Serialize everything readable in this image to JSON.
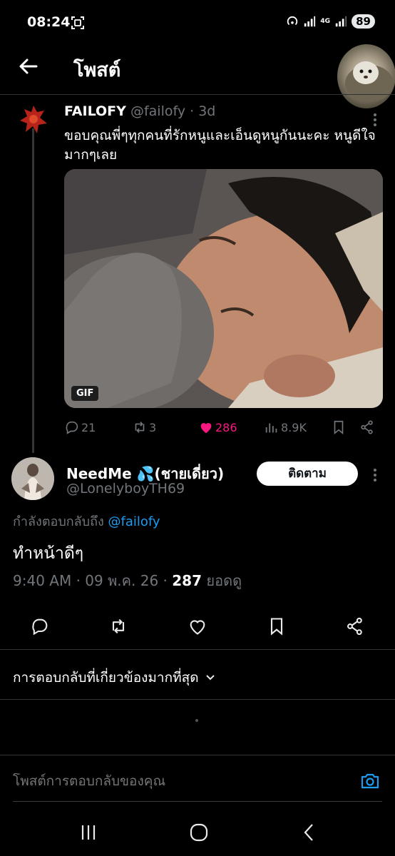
{
  "status_bar": {
    "time": "08:24",
    "network": "4G",
    "battery": "89"
  },
  "header": {
    "title": "โพสต์"
  },
  "parent_tweet": {
    "name": "FAILOFY",
    "handle": "@failofy",
    "age": "· 3d",
    "text": "ขอบคุณพี่ๆทุกคนที่รักหนูและเอ็นดูหนูกันนะคะ หนูดีใจมากๆเลย",
    "media_badge": "GIF",
    "replies": "21",
    "reposts": "3",
    "likes": "286",
    "views": "8.9K"
  },
  "main_tweet": {
    "name": "NeedMe 💦(ชายเดี่ยว)",
    "handle": "@LonelyboyTH69",
    "follow_label": "ติดตาม",
    "reply_prefix": "กำลังตอบกลับถึง",
    "reply_mention": "@failofy",
    "text": "ทำหน้าดีๆ",
    "timestamp": "9:40 AM · 09 พ.ค. 26 ·",
    "view_count": "287",
    "view_label": "ยอดดู"
  },
  "relevant_label": "การตอบกลับที่เกี่ยวข้องมากที่สุด",
  "compose": {
    "placeholder": "โพสต์การตอบกลับของคุณ"
  },
  "colors": {
    "accent": "#1d9bf0",
    "like": "#f91880",
    "muted": "#71767b"
  }
}
